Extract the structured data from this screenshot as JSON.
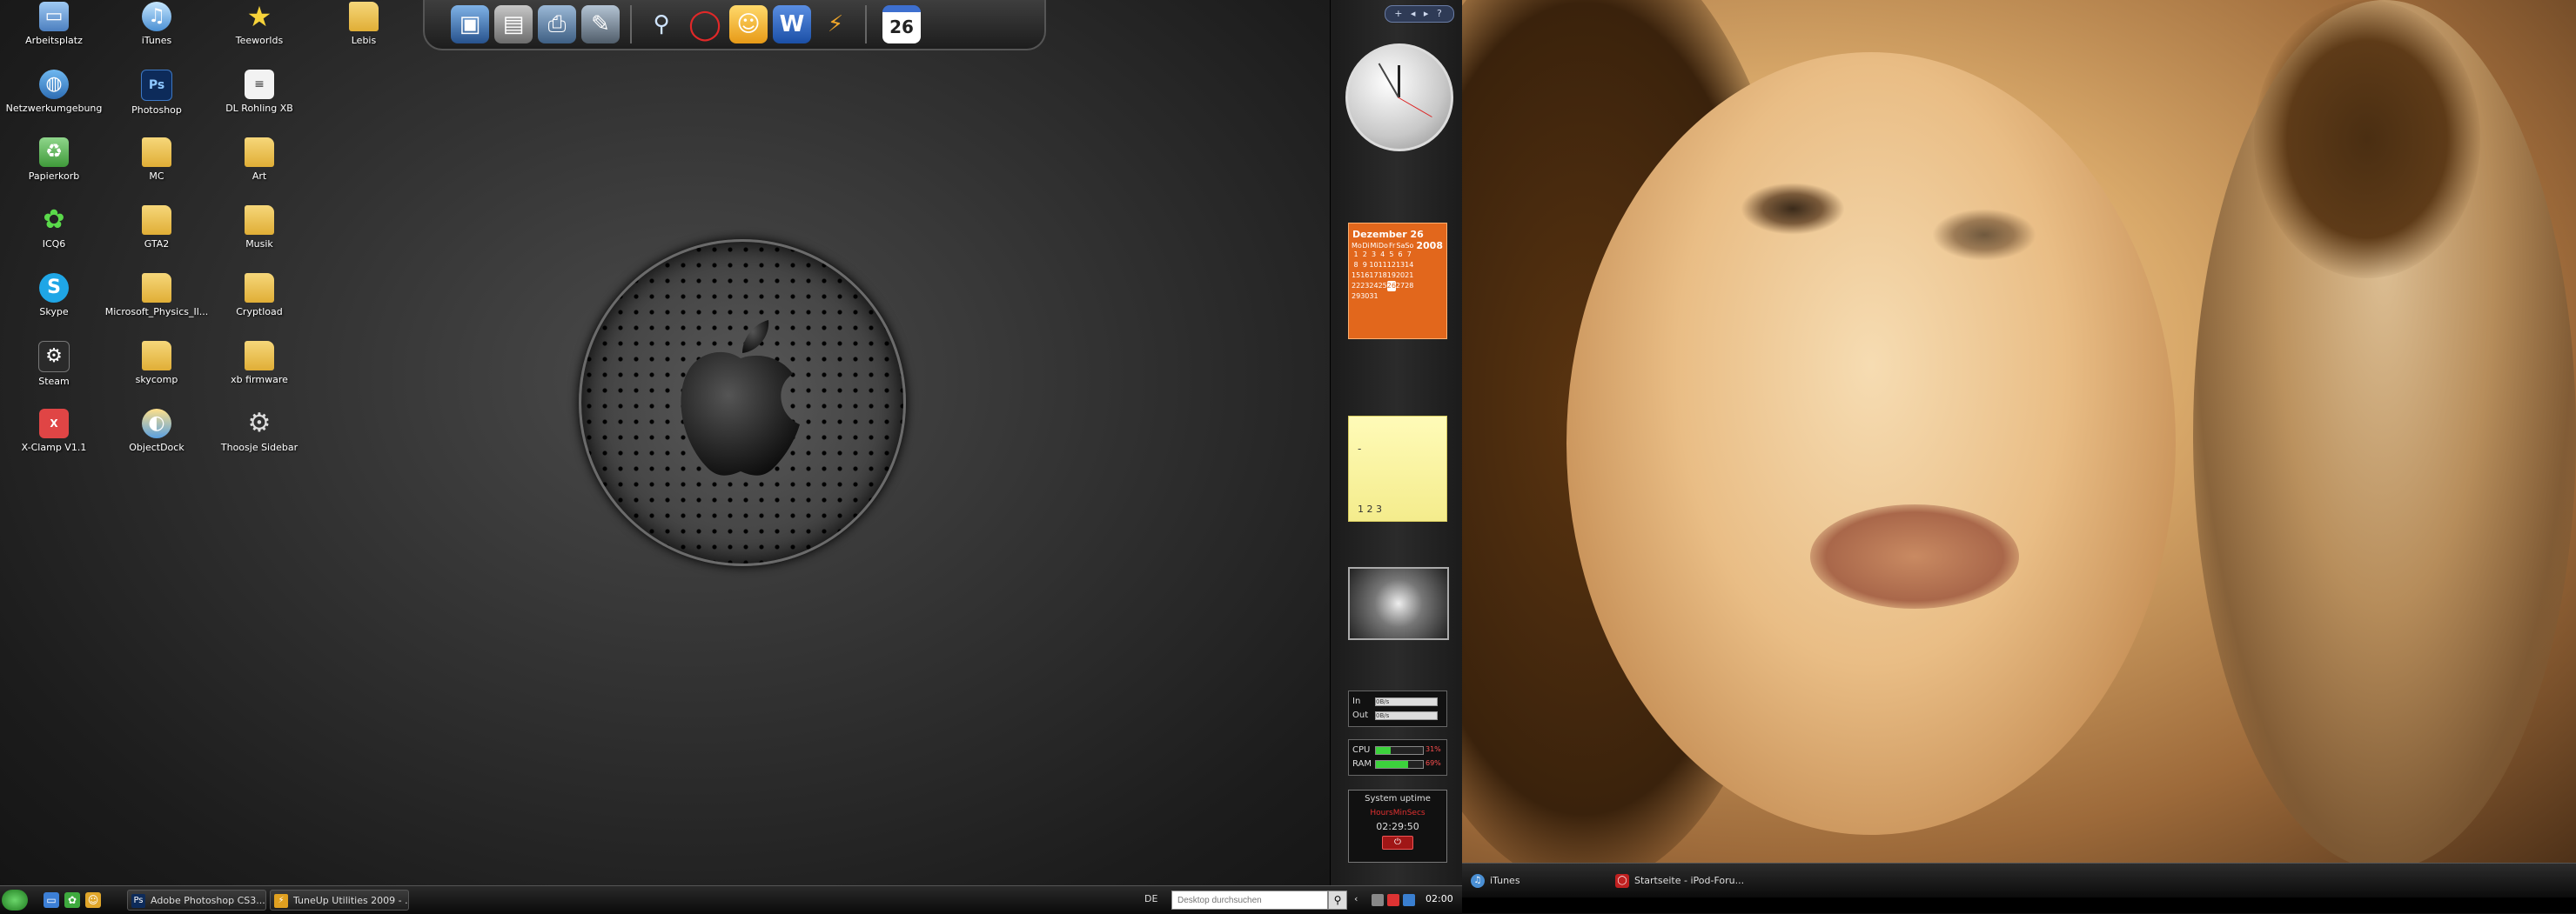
{
  "desktop_icons": [
    {
      "label": "Arbeitsplatz",
      "icon": "computer-icon"
    },
    {
      "label": "iTunes",
      "icon": "itunes-icon"
    },
    {
      "label": "Teeworlds",
      "icon": "star-icon"
    },
    {
      "label": "Lebis",
      "icon": "folder-icon"
    },
    {
      "label": "Netzwerkumgebung",
      "icon": "network-icon"
    },
    {
      "label": "Photoshop",
      "icon": "photoshop-icon"
    },
    {
      "label": "DL Rohling XB",
      "icon": "document-icon"
    },
    {
      "label": "Papierkorb",
      "icon": "recycle-bin-icon"
    },
    {
      "label": "MC",
      "icon": "folder-icon"
    },
    {
      "label": "Art",
      "icon": "folder-icon"
    },
    {
      "label": "ICQ6",
      "icon": "icq-icon"
    },
    {
      "label": "GTA2",
      "icon": "folder-icon"
    },
    {
      "label": "Musik",
      "icon": "folder-icon"
    },
    {
      "label": "Skype",
      "icon": "skype-icon"
    },
    {
      "label": "Microsoft_Physics_Il...",
      "icon": "folder-icon"
    },
    {
      "label": "Cryptload",
      "icon": "folder-icon"
    },
    {
      "label": "Steam",
      "icon": "steam-icon"
    },
    {
      "label": "skycomp",
      "icon": "folder-icon"
    },
    {
      "label": "xb firmware",
      "icon": "folder-icon"
    },
    {
      "label": "X-Clamp V1.1",
      "icon": "xclamp-icon"
    },
    {
      "label": "ObjectDock",
      "icon": "objectdock-icon"
    },
    {
      "label": "Thoosje Sidebar",
      "icon": "gear-icon"
    }
  ],
  "dock": {
    "calendar_day": "26"
  },
  "sidebar": {
    "controls": "+ ◂ ▸ ?",
    "calendar": {
      "month": "Dezember",
      "day": "26",
      "year": "2008",
      "weekdays": [
        "Mo",
        "Di",
        "Mi",
        "Do",
        "Fr",
        "Sa",
        "So"
      ],
      "weeks": [
        [
          "1",
          "2",
          "3",
          "4",
          "5",
          "6",
          "7"
        ],
        [
          "8",
          "9",
          "10",
          "11",
          "12",
          "13",
          "14"
        ],
        [
          "15",
          "16",
          "17",
          "18",
          "19",
          "20",
          "21"
        ],
        [
          "22",
          "23",
          "24",
          "25",
          "26",
          "27",
          "28"
        ],
        [
          "29",
          "30",
          "31",
          "",
          "",
          "",
          ""
        ]
      ],
      "today": "26"
    },
    "note": {
      "dash": "-",
      "text": "1 2 3"
    },
    "network": {
      "in_label": "In",
      "out_label": "Out",
      "in_value": "0B/s",
      "out_value": "0B/s"
    },
    "cpu": {
      "cpu_label": "CPU",
      "ram_label": "RAM",
      "cpu_pct": "31%",
      "ram_pct": "69%",
      "cpu_fill": 0.31,
      "ram_fill": 0.69
    },
    "uptime": {
      "title": "System uptime",
      "units": "HoursMinSecs",
      "value": "02:29:50"
    }
  },
  "taskbar": {
    "tasks": [
      {
        "label": "Adobe Photoshop CS3...",
        "icon": "photoshop-icon"
      },
      {
        "label": "TuneUp Utilities 2009 - ...",
        "icon": "tuneup-icon"
      }
    ],
    "language": "DE",
    "search_placeholder": "Desktop durchsuchen",
    "clock": "02:00"
  },
  "taskbar_right": {
    "tasks": [
      {
        "label": "iTunes",
        "icon": "itunes-icon"
      },
      {
        "label": "Startseite - iPod-Foru...",
        "icon": "browser-icon"
      }
    ]
  },
  "colors": {
    "calendar_orange": "#e2671c",
    "note_yellow": "#fffbb8",
    "start_green": "#3fae3f"
  }
}
